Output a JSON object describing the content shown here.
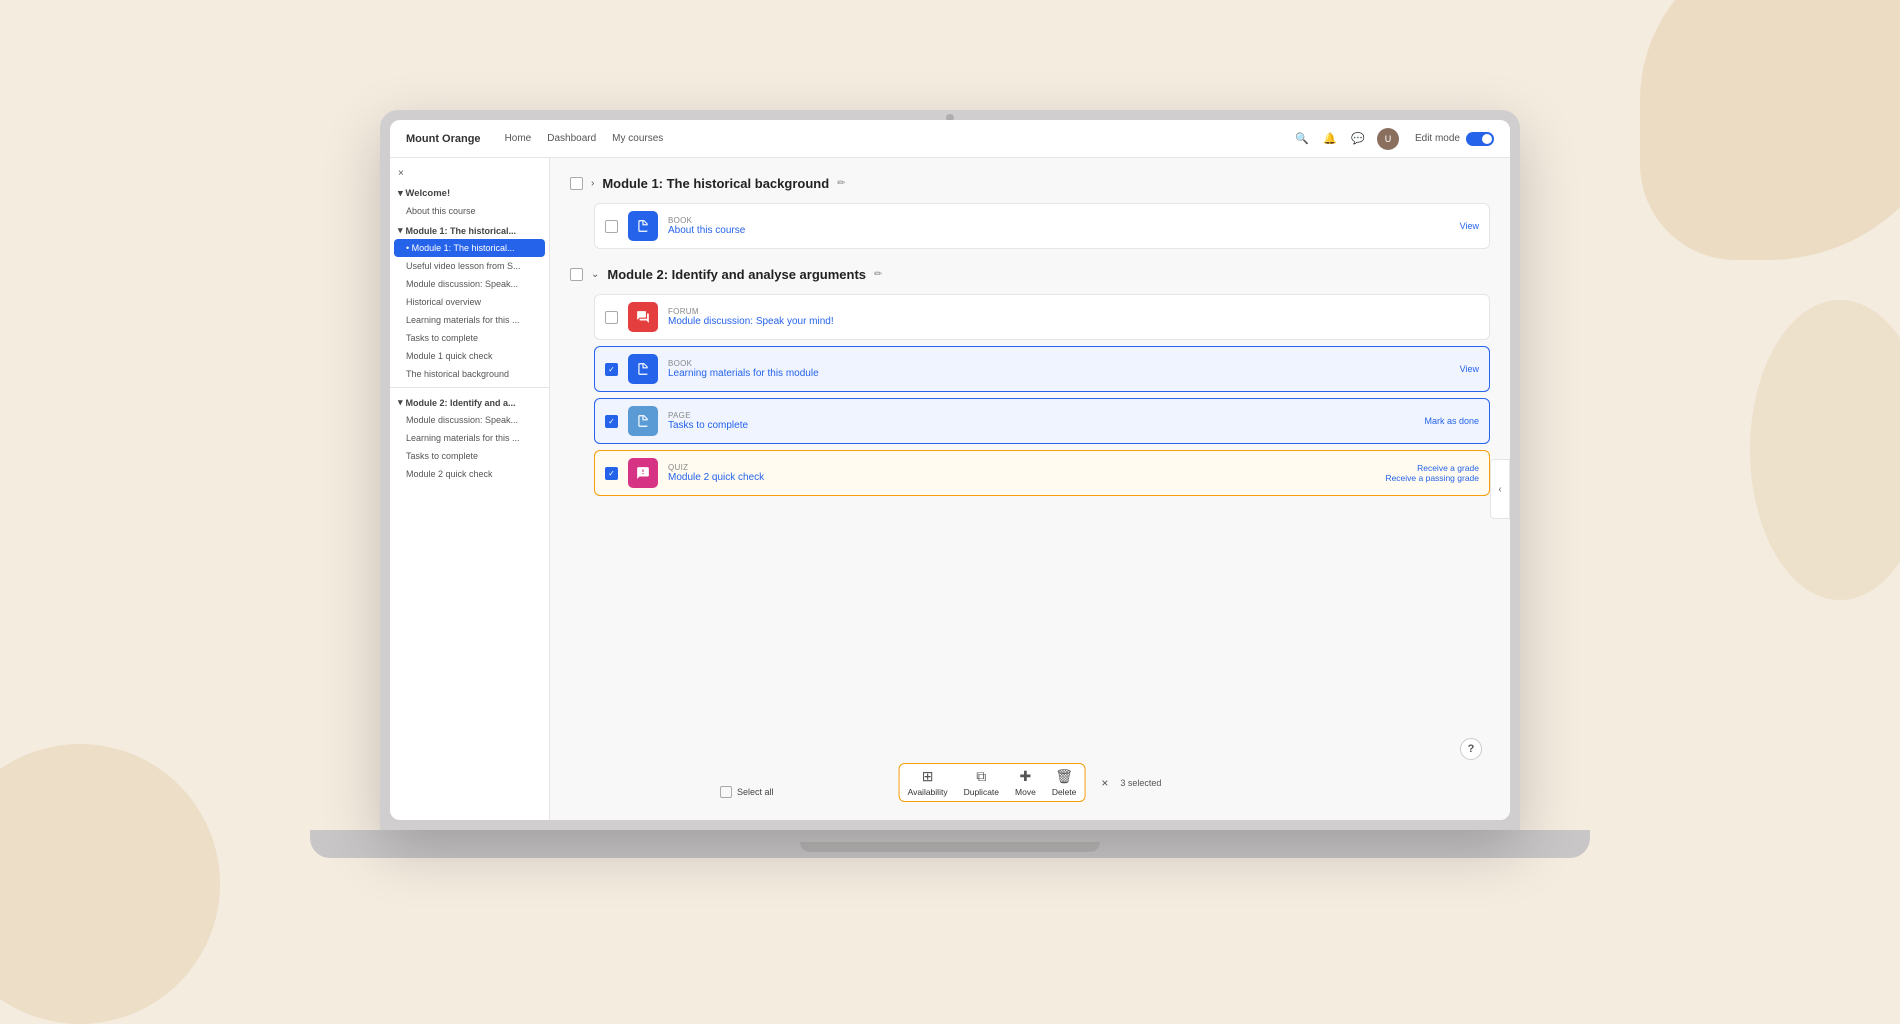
{
  "background": {
    "blobColors": [
      "#e8d5b7"
    ]
  },
  "navbar": {
    "brand": "Mount Orange",
    "links": [
      "Home",
      "Dashboard",
      "My courses"
    ],
    "editModeLabel": "Edit mode",
    "editModeOn": true
  },
  "sidebar": {
    "closeLabel": "×",
    "sections": [
      {
        "title": "Welcome!",
        "items": [
          "About this course"
        ]
      },
      {
        "title": "Module 1: The historical...",
        "active": true,
        "items": [
          "Useful video lesson from S...",
          "Module discussion: Speak...",
          "Historical overview",
          "Learning materials for this ...",
          "Tasks to complete",
          "Module 1 quick check",
          "The historical background"
        ]
      },
      {
        "title": "Module 2: Identify and a...",
        "items": [
          "Module discussion: Speak...",
          "Learning materials for this ...",
          "Tasks to complete",
          "Module 2 quick check"
        ]
      }
    ],
    "selectAllLabel": "Select all"
  },
  "modules": [
    {
      "id": "module1",
      "title": "Module 1: The historical background",
      "collapsed": true,
      "showEditIcon": true,
      "activities": [
        {
          "type": "BOOK",
          "name": "About this course",
          "actionLabel": "View",
          "iconType": "blue",
          "iconSymbol": "📖",
          "checked": false,
          "selected": false
        }
      ]
    },
    {
      "id": "module2",
      "title": "Module 2: Identify and analyse arguments",
      "collapsed": false,
      "showEditIcon": true,
      "activities": [
        {
          "type": "FORUM",
          "name": "Module discussion: Speak your mind!",
          "actionLabel": "",
          "iconType": "red",
          "iconSymbol": "💬",
          "checked": false,
          "selected": false
        },
        {
          "type": "BOOK",
          "name": "Learning materials for this module",
          "actionLabel": "View",
          "iconType": "blue",
          "iconSymbol": "📖",
          "checked": true,
          "selected": true
        },
        {
          "type": "PAGE",
          "name": "Tasks to complete",
          "actionLabel": "Mark as done",
          "iconType": "blue",
          "iconSymbol": "📄",
          "checked": true,
          "selected": true
        },
        {
          "type": "QUIZ",
          "name": "Module 2 quick check",
          "actionLabel": "Receive a grade",
          "actionLabel2": "Receive a passing grade",
          "iconType": "pink",
          "iconSymbol": "✏️",
          "checked": true,
          "selected": true
        }
      ]
    }
  ],
  "bottomBar": {
    "actions": [
      {
        "icon": "availability",
        "label": "Availability",
        "symbol": "⊞"
      },
      {
        "icon": "duplicate",
        "label": "Duplicate",
        "symbol": "⧉"
      },
      {
        "icon": "move",
        "label": "Move",
        "symbol": "✚"
      },
      {
        "icon": "delete",
        "label": "Delete",
        "symbol": "🗑"
      }
    ],
    "selectedCount": "3 selected",
    "selectAllLabel": "Select all"
  },
  "helpButton": "?",
  "collapseButton": "‹"
}
